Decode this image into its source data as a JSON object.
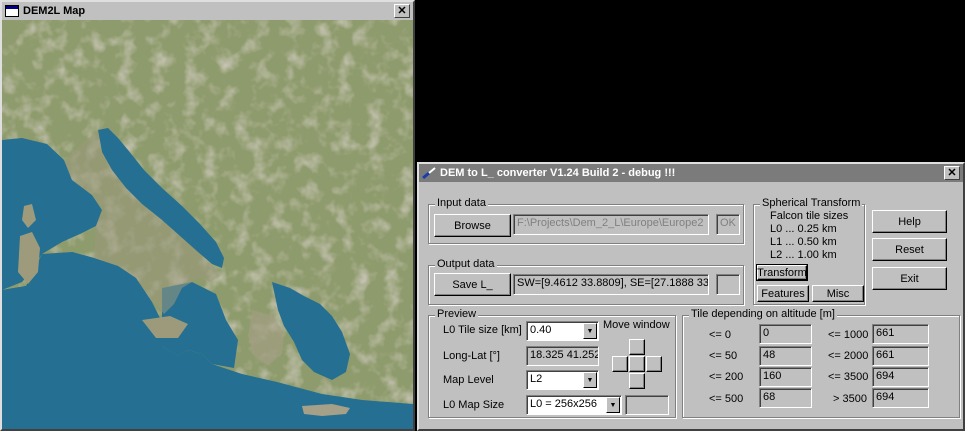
{
  "map_window": {
    "title": "DEM2L Map",
    "close_label": "✕"
  },
  "converter_window": {
    "title": "DEM to L_ converter V1.24 Build 2 - debug !!!",
    "close_label": "✕",
    "input_data": {
      "group_label": "Input data",
      "browse_label": "Browse",
      "path_value": "F:\\Projects\\Dem_2_L\\Europe\\Europe2",
      "ok_label": "OK"
    },
    "output_data": {
      "group_label": "Output data",
      "save_label": "Save L_",
      "coords_value": "SW=[9.4612 33.8809], SE=[27.1888 33",
      "extra_value": ""
    },
    "spherical": {
      "group_label": "Spherical Transform",
      "heading": "Falcon tile sizes",
      "l0": "L0 ... 0.25 km",
      "l1": "L1 ... 0.50 km",
      "l2": "L2 ... 1.00 km",
      "transform_label": "Transform",
      "features_label": "Features",
      "misc_label": "Misc"
    },
    "side_buttons": {
      "help": "Help",
      "reset": "Reset",
      "exit": "Exit"
    },
    "preview": {
      "group_label": "Preview",
      "move_window_label": "Move window",
      "tile_size_label": "L0 Tile size [km]",
      "tile_size_value": "0.40",
      "longlat_label": "Long-Lat [°]",
      "longlat_value": "18.325 41.252",
      "map_level_label": "Map Level",
      "map_level_value": "L2",
      "map_size_label": "L0 Map Size",
      "map_size_value": "L0 = 256x256",
      "map_size_extra": ""
    },
    "altitude": {
      "group_label": "Tile depending on altitude [m]",
      "rows_left": [
        {
          "label": "<= 0",
          "value": "0"
        },
        {
          "label": "<= 50",
          "value": "48"
        },
        {
          "label": "<= 200",
          "value": "160"
        },
        {
          "label": "<= 500",
          "value": "68"
        }
      ],
      "rows_right": [
        {
          "label": "<= 1000",
          "value": "661"
        },
        {
          "label": "<= 2000",
          "value": "661"
        },
        {
          "label": "<= 3500",
          "value": "694"
        },
        {
          "label": "> 3500",
          "value": "694"
        }
      ]
    }
  },
  "colors": {
    "sea": "#246f92",
    "land": "#8b9a6a",
    "mountain": "#b7a89c",
    "desktop": "#000000",
    "window_face": "#c0c0c0"
  }
}
